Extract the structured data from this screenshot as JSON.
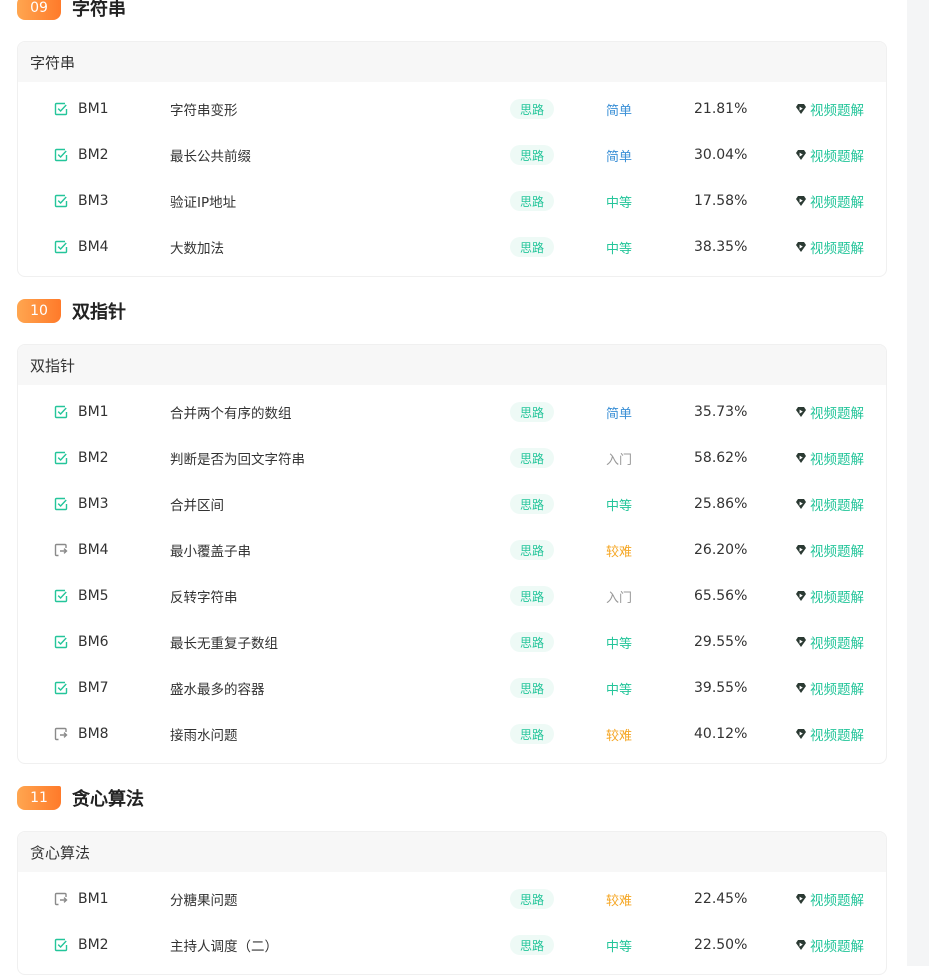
{
  "colors": {
    "easy": "#3a8fd6",
    "medium": "#24c59a",
    "intro": "#999999",
    "hard": "#f5a623",
    "accent": "#24c59a",
    "badge": "#ff8a33"
  },
  "sections": [
    {
      "num": "09",
      "title": "字符串",
      "card_title": "字符串",
      "items": [
        {
          "status": "done",
          "id": "BM1",
          "title": "字符串变形",
          "tag": "思路",
          "difficulty": "简单",
          "level": "easy",
          "rate": "21.81%",
          "video": "视频题解"
        },
        {
          "status": "done",
          "id": "BM2",
          "title": "最长公共前缀",
          "tag": "思路",
          "difficulty": "简单",
          "level": "easy",
          "rate": "30.04%",
          "video": "视频题解"
        },
        {
          "status": "done",
          "id": "BM3",
          "title": "验证IP地址",
          "tag": "思路",
          "difficulty": "中等",
          "level": "medium",
          "rate": "17.58%",
          "video": "视频题解"
        },
        {
          "status": "done",
          "id": "BM4",
          "title": "大数加法",
          "tag": "思路",
          "difficulty": "中等",
          "level": "medium",
          "rate": "38.35%",
          "video": "视频题解"
        }
      ]
    },
    {
      "num": "10",
      "title": "双指针",
      "card_title": "双指针",
      "items": [
        {
          "status": "done",
          "id": "BM1",
          "title": "合并两个有序的数组",
          "tag": "思路",
          "difficulty": "简单",
          "level": "easy",
          "rate": "35.73%",
          "video": "视频题解"
        },
        {
          "status": "done",
          "id": "BM2",
          "title": "判断是否为回文字符串",
          "tag": "思路",
          "difficulty": "入门",
          "level": "intro",
          "rate": "58.62%",
          "video": "视频题解"
        },
        {
          "status": "done",
          "id": "BM3",
          "title": "合并区间",
          "tag": "思路",
          "difficulty": "中等",
          "level": "medium",
          "rate": "25.86%",
          "video": "视频题解"
        },
        {
          "status": "todo",
          "id": "BM4",
          "title": "最小覆盖子串",
          "tag": "思路",
          "difficulty": "较难",
          "level": "hard",
          "rate": "26.20%",
          "video": "视频题解"
        },
        {
          "status": "done",
          "id": "BM5",
          "title": "反转字符串",
          "tag": "思路",
          "difficulty": "入门",
          "level": "intro",
          "rate": "65.56%",
          "video": "视频题解"
        },
        {
          "status": "done",
          "id": "BM6",
          "title": "最长无重复子数组",
          "tag": "思路",
          "difficulty": "中等",
          "level": "medium",
          "rate": "29.55%",
          "video": "视频题解"
        },
        {
          "status": "done",
          "id": "BM7",
          "title": "盛水最多的容器",
          "tag": "思路",
          "difficulty": "中等",
          "level": "medium",
          "rate": "39.55%",
          "video": "视频题解"
        },
        {
          "status": "todo",
          "id": "BM8",
          "title": "接雨水问题",
          "tag": "思路",
          "difficulty": "较难",
          "level": "hard",
          "rate": "40.12%",
          "video": "视频题解"
        }
      ]
    },
    {
      "num": "11",
      "title": "贪心算法",
      "card_title": "贪心算法",
      "items": [
        {
          "status": "todo",
          "id": "BM1",
          "title": "分糖果问题",
          "tag": "思路",
          "difficulty": "较难",
          "level": "hard",
          "rate": "22.45%",
          "video": "视频题解"
        },
        {
          "status": "done",
          "id": "BM2",
          "title": "主持人调度（二）",
          "tag": "思路",
          "difficulty": "中等",
          "level": "medium",
          "rate": "22.50%",
          "video": "视频题解"
        }
      ]
    }
  ]
}
